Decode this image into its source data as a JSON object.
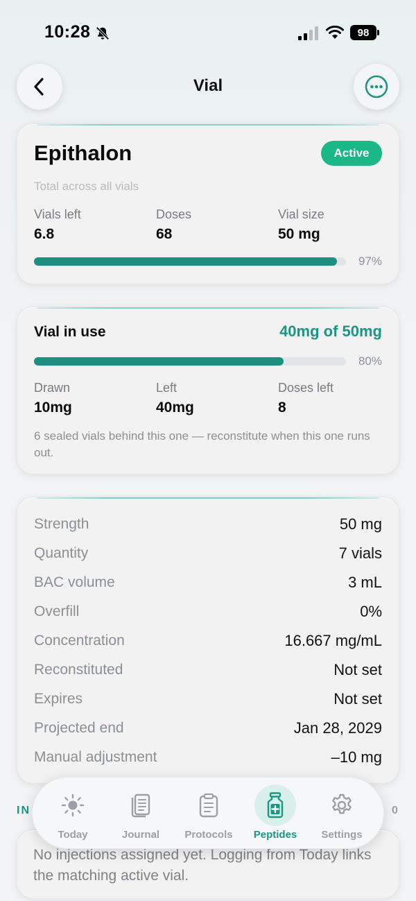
{
  "status_bar": {
    "time": "10:28",
    "battery": "98"
  },
  "header": {
    "title": "Vial"
  },
  "summary": {
    "name": "Epithalon",
    "status": "Active",
    "note": "Total across all vials",
    "stats": [
      {
        "label": "Vials left",
        "value": "6.8"
      },
      {
        "label": "Doses",
        "value": "68"
      },
      {
        "label": "Vial size",
        "value": "50 mg"
      }
    ],
    "progress_percent": 97,
    "progress_label": "97%"
  },
  "vial_in_use": {
    "title": "Vial in use",
    "amount": "40mg of 50mg",
    "progress_percent": 80,
    "progress_label": "80%",
    "stats": [
      {
        "label": "Drawn",
        "value": "10mg"
      },
      {
        "label": "Left",
        "value": "40mg"
      },
      {
        "label": "Doses left",
        "value": "8"
      }
    ],
    "note": "6 sealed vials behind this one — reconstitute when this one runs out."
  },
  "details": [
    {
      "label": "Strength",
      "value": "50 mg"
    },
    {
      "label": "Quantity",
      "value": "7 vials"
    },
    {
      "label": "BAC volume",
      "value": "3 mL"
    },
    {
      "label": "Overfill",
      "value": "0%"
    },
    {
      "label": "Concentration",
      "value": "16.667 mg/mL"
    },
    {
      "label": "Reconstituted",
      "value": "Not set"
    },
    {
      "label": "Expires",
      "value": "Not set"
    },
    {
      "label": "Projected end",
      "value": "Jan 28, 2029"
    },
    {
      "label": "Manual adjustment",
      "value": "–10 mg"
    }
  ],
  "injections": {
    "section_label": "IN",
    "count": "0",
    "empty_note": "No injections assigned yet. Logging from Today links the matching active vial."
  },
  "tab_bar": {
    "items": [
      {
        "label": "Today",
        "icon": "sun-icon"
      },
      {
        "label": "Journal",
        "icon": "journal-icon"
      },
      {
        "label": "Protocols",
        "icon": "clipboard-icon"
      },
      {
        "label": "Peptides",
        "icon": "vial-icon"
      },
      {
        "label": "Settings",
        "icon": "gear-icon"
      }
    ],
    "active": "Peptides"
  },
  "colors": {
    "accent": "#1b9685",
    "badge": "#1ab887",
    "progress": "#1b8f80"
  }
}
